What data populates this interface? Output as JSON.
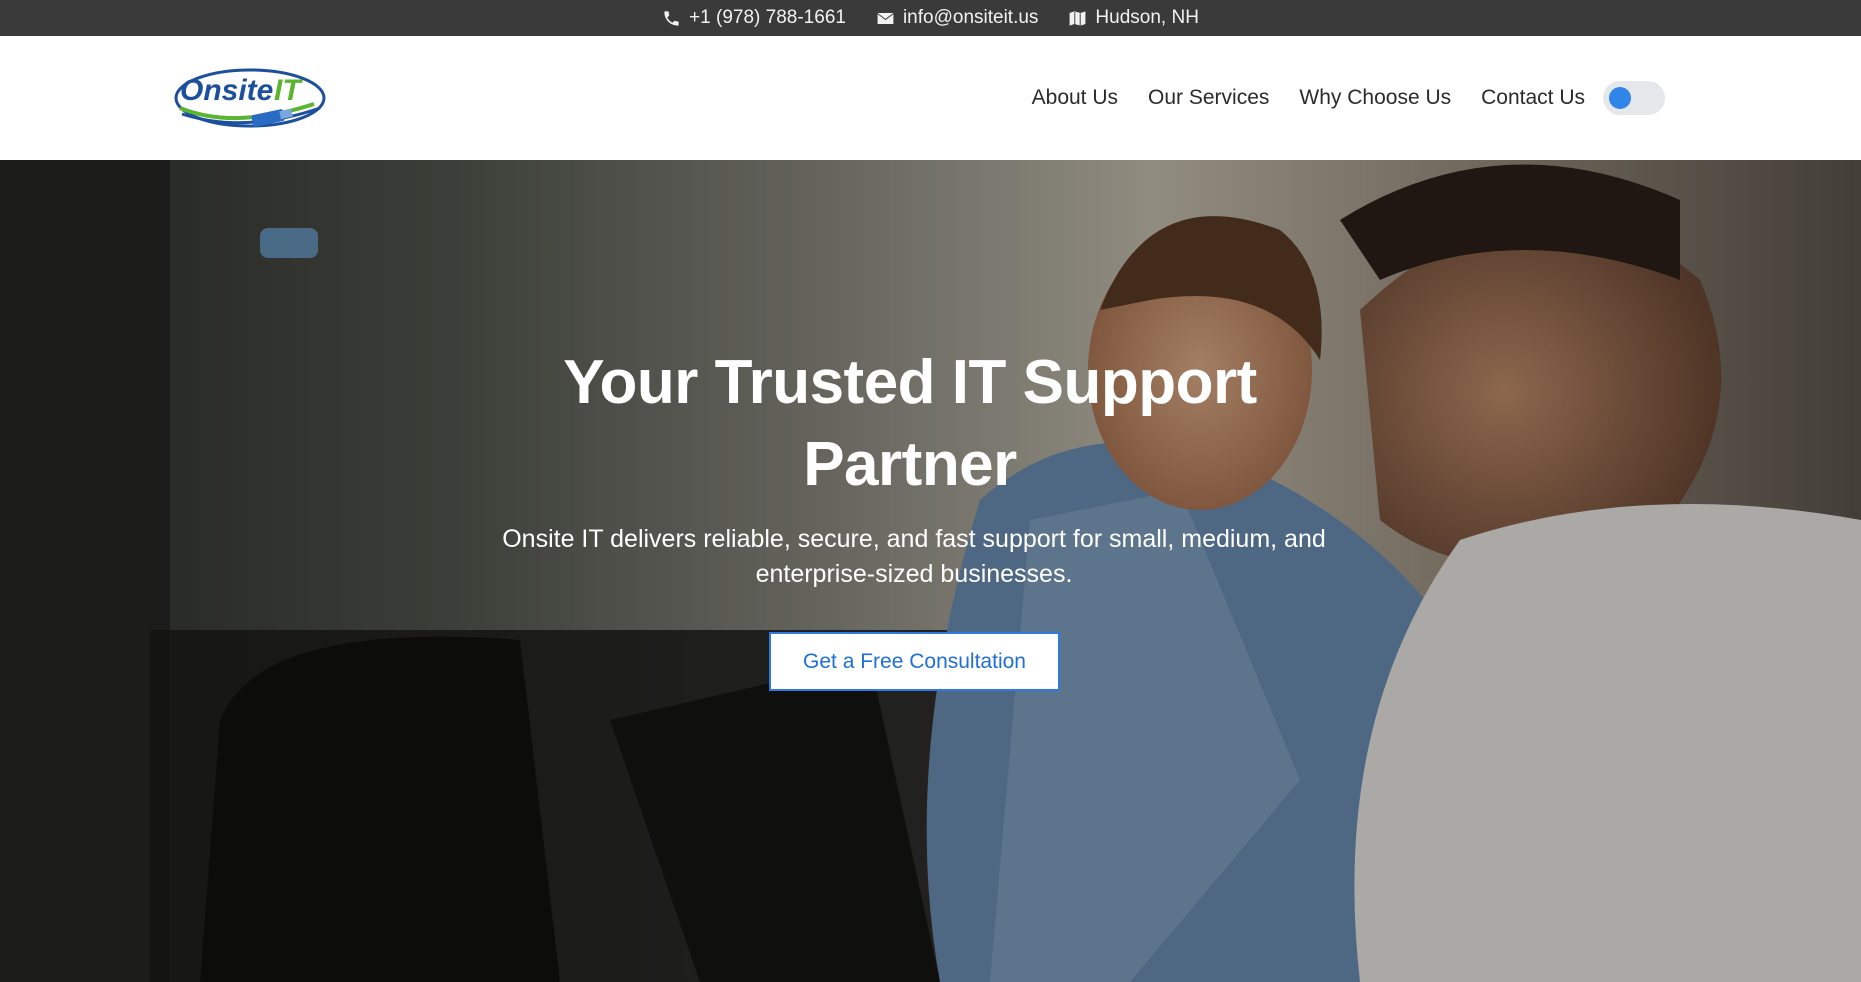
{
  "topbar": {
    "phone": "+1 (978) 788-1661",
    "email": "info@onsiteit.us",
    "location": "Hudson, NH"
  },
  "header": {
    "logo_text": "Onsite IT",
    "nav": [
      "About Us",
      "Our Services",
      "Why Choose Us",
      "Contact Us"
    ]
  },
  "hero": {
    "title": "Your Trusted IT Support Partner",
    "subtitle": "Onsite IT delivers reliable, secure, and fast support for small, medium, and enterprise-sized businesses.",
    "cta_label": "Get a Free Consultation"
  },
  "colors": {
    "topbar_bg": "#3a3a3a",
    "accent": "#2c7be5",
    "logo_blue": "#1c4f9c",
    "logo_green": "#5cb531"
  }
}
